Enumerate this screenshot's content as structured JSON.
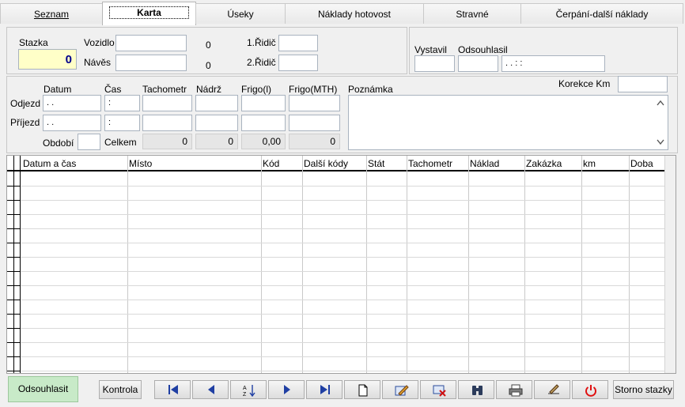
{
  "tabs": [
    "Seznam",
    "Karta",
    "Úseky",
    "Náklady hotovost",
    "Stravné",
    "Čerpání-další náklady"
  ],
  "header": {
    "stazka_label": "Stazka",
    "stazka_value": "0",
    "vozidlo_label": "Vozidlo",
    "vozidlo_value": "",
    "vozidlo_num": "0",
    "naves_label": "Návěs",
    "naves_value": "",
    "naves_num": "0",
    "ridic1_label": "1.Řidič",
    "ridic2_label": "2.Řidič",
    "vystavil_label": "Vystavil",
    "odsouhlasil_label": "Odsouhlasil",
    "odsouhlasil_datetime": " .  .      :  :"
  },
  "trip": {
    "col_datum": "Datum",
    "col_cas": "Čas",
    "col_tachometr": "Tachometr",
    "col_nadrz": "Nádrž",
    "col_frigo_l": "Frigo(l)",
    "col_frigo_mth": "Frigo(MTH)",
    "poznamka_label": "Poznámka",
    "korekce_label": "Korekce Km",
    "odjezd_label": "Odjezd",
    "prijezd_label": "Příjezd",
    "obdobi_label": "Období",
    "celkem_label": "Celkem",
    "date_placeholder": " .  .",
    "time_placeholder": ":",
    "celkem_tachometr": "0",
    "celkem_nadrz": "0",
    "celkem_frigo_l": "0,00",
    "celkem_frigo_mth": "0"
  },
  "grid": {
    "columns": [
      "Datum a čas",
      "Místo",
      "Kód",
      "Další kódy",
      "Stát",
      "Tachometr",
      "Náklad",
      "Zakázka",
      "km",
      "Doba"
    ]
  },
  "footer": {
    "odsouhlasit": "Odsouhlasit",
    "kontrola": "Kontrola",
    "storno": "Storno stazky"
  }
}
